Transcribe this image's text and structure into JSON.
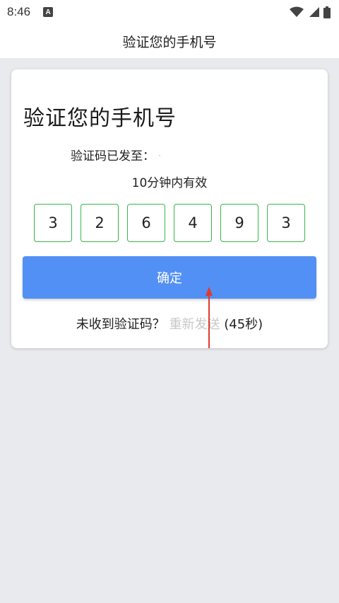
{
  "status_bar": {
    "time": "8:46",
    "notification_icon": "a-icon",
    "icons": [
      "wifi-icon",
      "signal-icon",
      "battery-icon"
    ]
  },
  "app_bar": {
    "title": "验证您的手机号"
  },
  "card": {
    "title": "验证您的手机号",
    "sent_to_label": "验证码已发至：",
    "sent_to_number": "·",
    "validity_text": "10分钟内有效",
    "code_digits": [
      "3",
      "2",
      "6",
      "4",
      "9",
      "3"
    ],
    "confirm_label": "确定",
    "not_received_text": "未收到验证码？",
    "resend_label": "重新发送",
    "countdown_text": "(45秒)"
  },
  "colors": {
    "confirm_button": "#5290f5",
    "code_border": "#3cb44a",
    "resend_disabled": "#c8c8c8",
    "annotation_arrow": "#e03a2f"
  }
}
